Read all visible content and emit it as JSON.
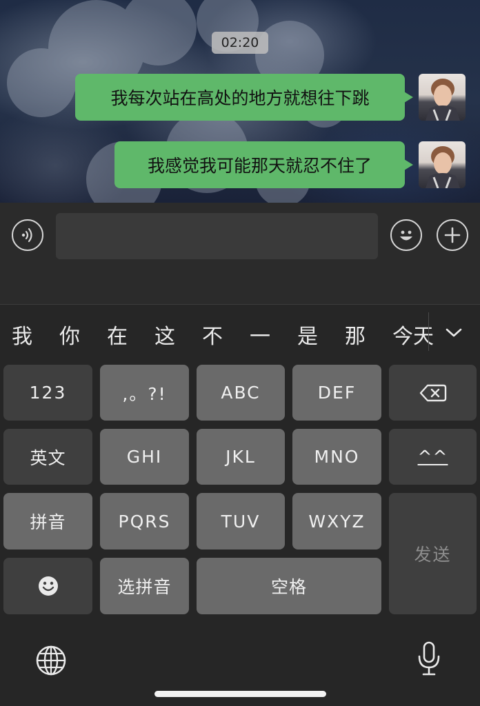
{
  "chat": {
    "timestamp": "02:20",
    "messages": [
      {
        "text": "我每次站在高处的地方就想往下跳",
        "sender": "me"
      },
      {
        "text": "我感觉我可能那天就忍不住了",
        "sender": "me"
      }
    ]
  },
  "input_bar": {
    "value": "",
    "icons": [
      "voice-icon",
      "emoji-icon",
      "plus-icon"
    ]
  },
  "keyboard": {
    "candidates": [
      "我",
      "你",
      "在",
      "这",
      "不",
      "一",
      "是",
      "那",
      "今天"
    ],
    "keys": {
      "numbers": "123",
      "punct": ",。?!",
      "abc": "ABC",
      "def": "DEF",
      "english": "英文",
      "ghi": "GHI",
      "jkl": "JKL",
      "mno": "MNO",
      "kaomoji": "^^",
      "pinyin": "拼音",
      "pqrs": "PQRS",
      "tuv": "TUV",
      "wxyz": "WXYZ",
      "send": "发送",
      "select_pinyin": "选拼音",
      "space": "空格"
    },
    "icons": [
      "backspace-icon",
      "smiley-icon",
      "globe-icon",
      "microphone-icon",
      "chevron-down-icon"
    ]
  },
  "colors": {
    "bubble": "#5fb86a",
    "keyboard_bg": "#262626",
    "key_dark": "#3f3f3f",
    "key_light": "#5e5e5e"
  }
}
